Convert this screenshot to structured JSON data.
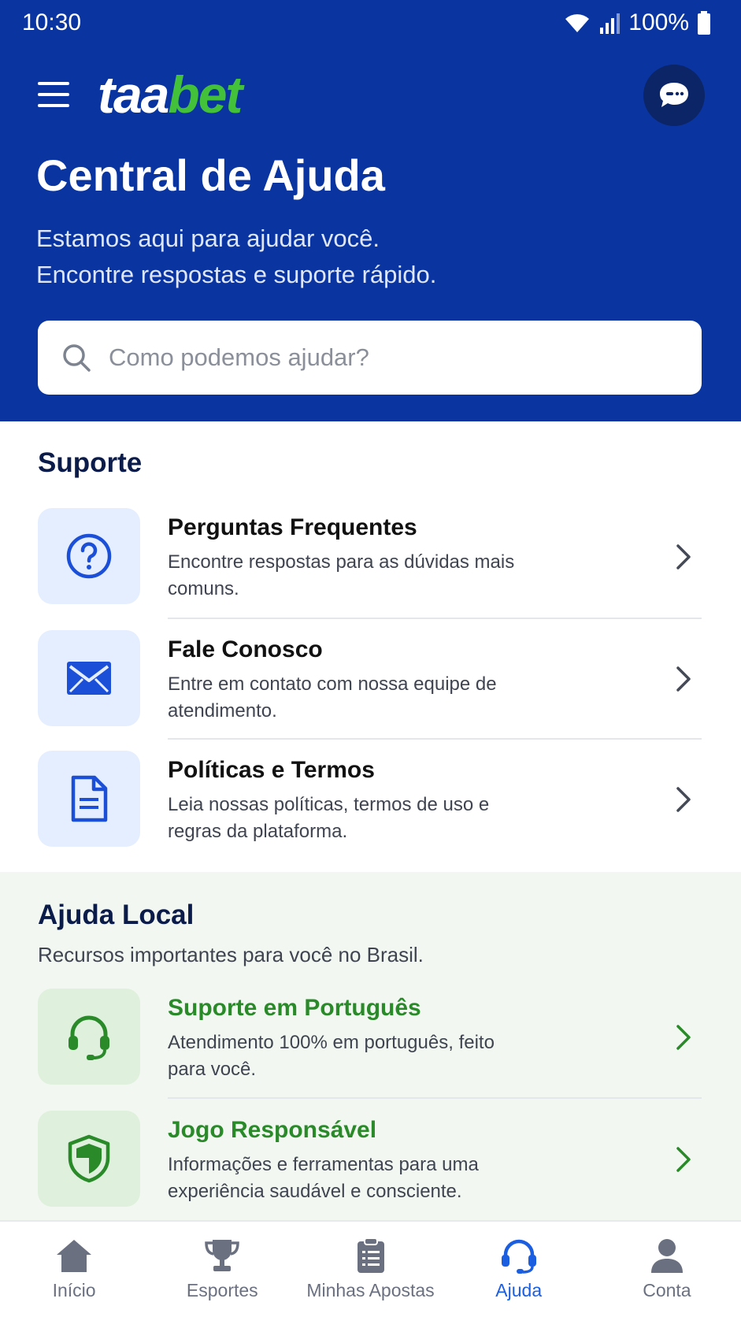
{
  "status": {
    "time": "10:30",
    "battery": "100%"
  },
  "header": {
    "logo_part1": "taa",
    "logo_part2": "bet",
    "title": "Central de Ajuda",
    "subtitle_line1": "Estamos aqui para ajudar você.",
    "subtitle_line2": "Encontre respostas e suporte rápido."
  },
  "search": {
    "placeholder": "Como podemos ajudar?"
  },
  "support": {
    "title": "Suporte",
    "items": [
      {
        "title": "Perguntas Frequentes",
        "desc": "Encontre respostas para as dúvidas mais comuns.",
        "icon": "question-icon"
      },
      {
        "title": "Fale Conosco",
        "desc": "Entre em contato com nossa equipe de atendimento.",
        "icon": "mail-icon"
      },
      {
        "title": "Políticas e Termos",
        "desc": "Leia nossas políticas, termos de uso e regras da plataforma.",
        "icon": "document-icon"
      }
    ]
  },
  "local": {
    "title": "Ajuda Local",
    "subtitle": "Recursos importantes para você no Brasil.",
    "items": [
      {
        "title": "Suporte em Português",
        "desc": "Atendimento 100% em português, feito para você.",
        "icon": "headset-icon"
      },
      {
        "title": "Jogo Responsável",
        "desc": "Informações e ferramentas para uma experiência saudável e consciente.",
        "icon": "shield-icon"
      }
    ]
  },
  "nav": {
    "items": [
      {
        "label": "Início",
        "icon": "home-icon"
      },
      {
        "label": "Esportes",
        "icon": "trophy-icon"
      },
      {
        "label": "Minhas Apostas",
        "icon": "clipboard-icon"
      },
      {
        "label": "Ajuda",
        "icon": "headset-icon",
        "active": true
      },
      {
        "label": "Conta",
        "icon": "user-icon"
      }
    ]
  },
  "colors": {
    "primary": "#0a35a1",
    "accent_green": "#44c13a",
    "active_nav": "#1c5ee0"
  }
}
